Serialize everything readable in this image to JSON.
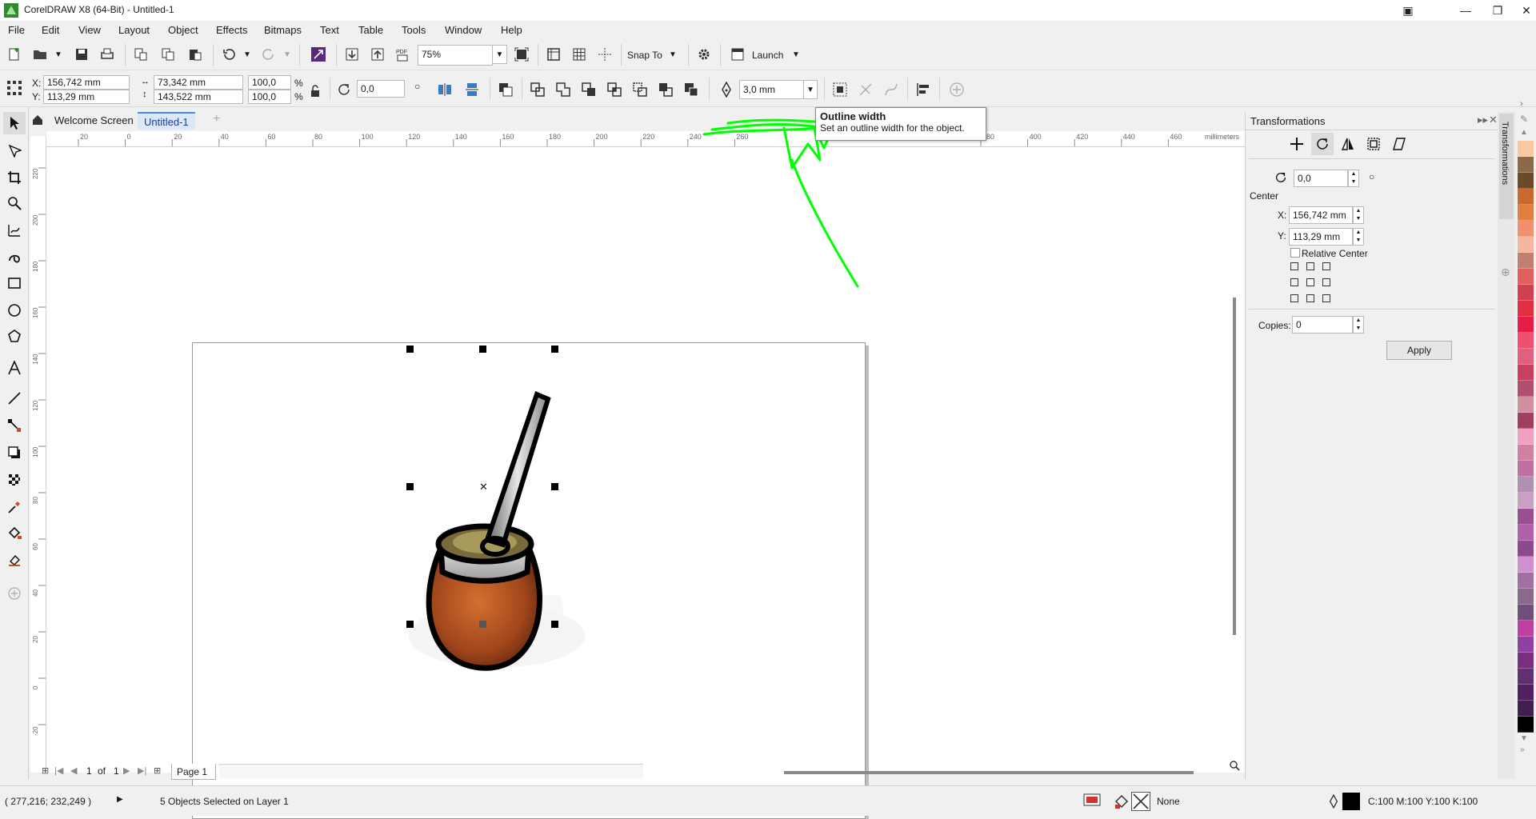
{
  "window": {
    "title": "CorelDRAW X8 (64-Bit) - Untitled-1"
  },
  "menu": [
    "File",
    "Edit",
    "View",
    "Layout",
    "Object",
    "Effects",
    "Bitmaps",
    "Text",
    "Table",
    "Tools",
    "Window",
    "Help"
  ],
  "standard_bar": {
    "zoom": "75%",
    "snap_to": "Snap To",
    "launch": "Launch"
  },
  "property_bar": {
    "x_label": "X:",
    "x_value": "156,742 mm",
    "y_label": "Y:",
    "y_value": "113,29 mm",
    "width_value": "73,342 mm",
    "height_value": "143,522 mm",
    "scale_x": "100,0",
    "scale_y": "100,0",
    "pct": "%",
    "rotation": "0,0",
    "outline_width": "3,0 mm"
  },
  "tabs": {
    "welcome": "Welcome Screen",
    "doc": "Untitled-1"
  },
  "ruler": {
    "h_labels": [
      "20",
      "0",
      "20",
      "40",
      "60",
      "80",
      "100",
      "120",
      "140",
      "160",
      "180",
      "200",
      "220",
      "240",
      "260",
      "380",
      "400",
      "420",
      "440",
      "460"
    ],
    "h_unit": "millimeters",
    "v_labels": [
      "220",
      "200",
      "180",
      "160",
      "140",
      "120",
      "100",
      "80",
      "60",
      "40",
      "20",
      "0",
      "-20"
    ]
  },
  "tooltip": {
    "title": "Outline width",
    "desc": "Set an outline width for the object."
  },
  "docker": {
    "title": "Transformations",
    "rotation": "0,0",
    "center_label": "Center",
    "x_label": "X:",
    "x_value": "156,742 mm",
    "y_label": "Y:",
    "y_value": "113,29 mm",
    "relative_center": "Relative Center",
    "copies_label": "Copies:",
    "copies_value": "0",
    "apply": "Apply",
    "vertical_tab": "Transformations"
  },
  "page_nav": {
    "current": "1",
    "of": "of",
    "total": "1",
    "page_tab": "Page 1"
  },
  "status": {
    "coords": "( 277,216; 232,249 )",
    "selection": "5 Objects Selected on Layer 1",
    "fill": "None",
    "outline": "C:100 M:100 Y:100 K:100"
  },
  "palette": [
    "#f8c9a0",
    "#8a6a4a",
    "#6b4a2a",
    "#c86a30",
    "#e08040",
    "#f09070",
    "#f4b8a0",
    "#c08070",
    "#e06060",
    "#d04050",
    "#e03040",
    "#e81c48",
    "#f05070",
    "#e06080",
    "#c84060",
    "#b05070",
    "#d090a0",
    "#a04060",
    "#f0a0c0",
    "#d080a0",
    "#c070a0",
    "#b090b0",
    "#c8a0c0",
    "#9a5090",
    "#b060a8",
    "#8c4a8c",
    "#d090d0",
    "#a070a0",
    "#8a6a8a",
    "#70507a",
    "#c040a0",
    "#9040a0",
    "#7a3080",
    "#603070",
    "#502060",
    "#402050",
    "#000000"
  ],
  "colors": {
    "accent_green": "#00ff00",
    "gourd": "#a0461c",
    "straw": "#b8b8b8"
  }
}
